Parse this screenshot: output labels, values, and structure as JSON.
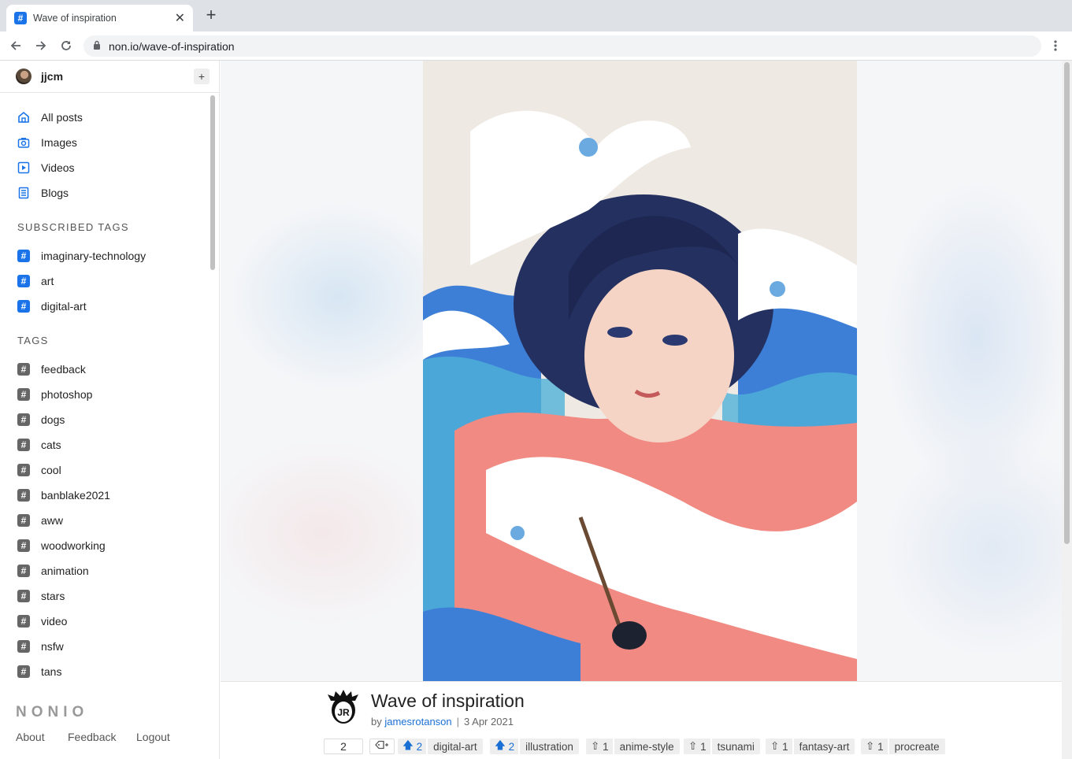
{
  "browser": {
    "tab_title": "Wave of inspiration",
    "tab_favicon": "#",
    "url": "non.io/wave-of-inspiration"
  },
  "user": {
    "name": "jjcm"
  },
  "nav": [
    {
      "label": "All posts",
      "icon": "home-icon"
    },
    {
      "label": "Images",
      "icon": "camera-icon"
    },
    {
      "label": "Videos",
      "icon": "play-icon"
    },
    {
      "label": "Blogs",
      "icon": "document-icon"
    }
  ],
  "subscribed_title": "SUBSCRIBED TAGS",
  "subscribed_tags": [
    "imaginary-technology",
    "art",
    "digital-art"
  ],
  "tags_title": "TAGS",
  "tags": [
    "feedback",
    "photoshop",
    "dogs",
    "cats",
    "cool",
    "banblake2021",
    "aww",
    "woodworking",
    "animation",
    "stars",
    "video",
    "nsfw",
    "tans"
  ],
  "brand": "NONIO",
  "footer": {
    "about": "About",
    "feedback": "Feedback",
    "logout": "Logout"
  },
  "post": {
    "title": "Wave of inspiration",
    "by": "by",
    "author": "jamesrotanson",
    "date": "3 Apr 2021",
    "score": "2",
    "author_avatar_initials": "JR"
  },
  "post_tags": [
    {
      "votes": "2",
      "name": "digital-art",
      "upvoted": true
    },
    {
      "votes": "2",
      "name": "illustration",
      "upvoted": true
    },
    {
      "votes": "1",
      "name": "anime-style",
      "upvoted": false
    },
    {
      "votes": "1",
      "name": "tsunami",
      "upvoted": false
    },
    {
      "votes": "1",
      "name": "fantasy-art",
      "upvoted": false
    },
    {
      "votes": "1",
      "name": "procreate",
      "upvoted": false
    }
  ],
  "colors": {
    "accent": "#1a73e8",
    "link": "#1a6fd4",
    "tag_bg": "#eeeeee"
  }
}
